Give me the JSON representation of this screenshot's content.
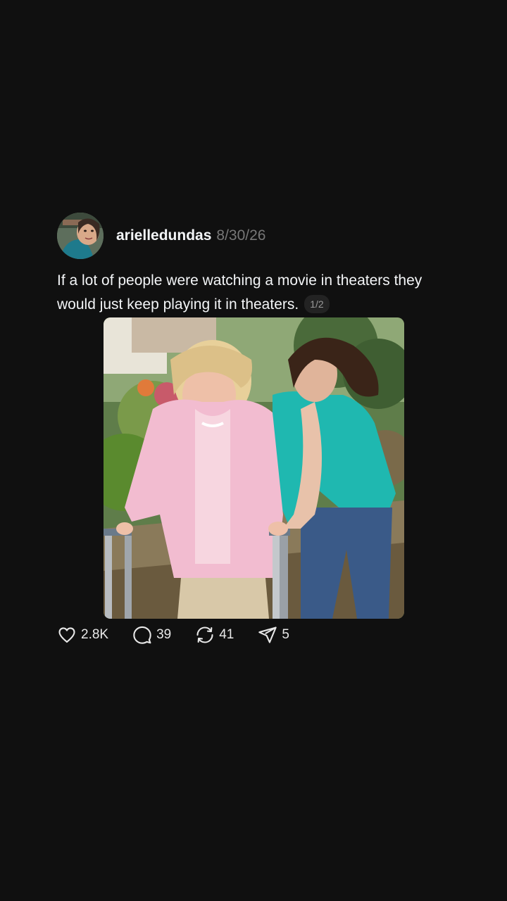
{
  "post": {
    "username": "arielledundas",
    "date": "8/30/26",
    "caption": "If a lot of people were watching a movie in theaters they would just keep playing it in theaters.",
    "pager": "1/2"
  },
  "actions": {
    "likes": "2.8K",
    "comments": "39",
    "reposts": "41",
    "shares": "5"
  },
  "icons": [
    "heart-icon",
    "comment-icon",
    "repost-icon",
    "share-icon"
  ],
  "colors": {
    "background": "#101010",
    "text": "#f3f5f7",
    "muted": "#777777"
  }
}
